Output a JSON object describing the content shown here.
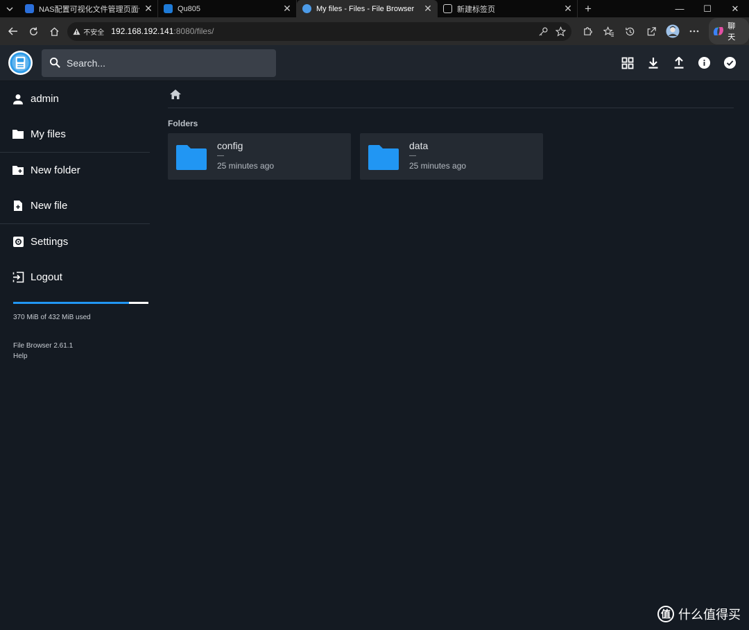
{
  "browser": {
    "tabs": [
      {
        "title": "NAS配置可视化文件管理页面保姆",
        "close": "✕",
        "favicon_color": "#2a6fdb"
      },
      {
        "title": "Qu805",
        "close": "✕",
        "favicon_color": "#1e7bd8"
      },
      {
        "title": "My files - Files - File Browser",
        "close": "✕",
        "favicon_color": "#4c9be8",
        "active": true
      },
      {
        "title": "新建标签页",
        "close": "✕",
        "favicon_color": "#cfcfcf"
      }
    ],
    "new_tab": "+",
    "window_controls": {
      "minimize": "—",
      "maximize": "☐",
      "close": "✕"
    },
    "address": {
      "security": "不安全",
      "host": "192.168.192.141",
      "path": ":8080/files/"
    },
    "chat_label": "聊天"
  },
  "app": {
    "search_placeholder": "Search...",
    "header_actions": [
      "grid-view-icon",
      "download-icon",
      "upload-icon",
      "info-icon",
      "select-icon"
    ],
    "sidebar": {
      "user": "admin",
      "items": [
        {
          "label": "My files",
          "icon": "folder-icon"
        },
        {
          "label": "New folder",
          "icon": "new-folder-icon"
        },
        {
          "label": "New file",
          "icon": "new-file-icon"
        },
        {
          "label": "Settings",
          "icon": "settings-icon"
        },
        {
          "label": "Logout",
          "icon": "logout-icon"
        }
      ],
      "usage_text": "370 MiB of 432 MiB used",
      "usage_fraction": 0.8565,
      "version": "File Browser 2.61.1",
      "help": "Help"
    },
    "main": {
      "section_title": "Folders",
      "folders": [
        {
          "name": "config",
          "size": "—",
          "modified": "25 minutes ago"
        },
        {
          "name": "data",
          "size": "—",
          "modified": "25 minutes ago"
        }
      ],
      "folder_color": "#2196f3"
    }
  },
  "watermark": {
    "logo": "值",
    "text": "什么值得买"
  }
}
